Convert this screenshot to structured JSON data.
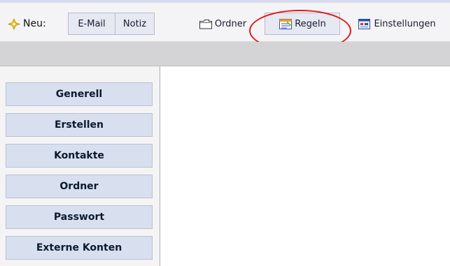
{
  "toolbar": {
    "new_label": "Neu:",
    "new_icon": "sparkle-star-icon",
    "email_label": "E-Mail",
    "note_label": "Notiz",
    "folder_label": "Ordner",
    "folder_icon": "folder-icon",
    "rules_label": "Regeln",
    "rules_icon": "rules-icon",
    "settings_label": "Einstellungen",
    "settings_icon": "settings-icon"
  },
  "sidebar": {
    "items": [
      {
        "label": "Generell"
      },
      {
        "label": "Erstellen"
      },
      {
        "label": "Kontakte"
      },
      {
        "label": "Ordner"
      },
      {
        "label": "Passwort"
      },
      {
        "label": "Externe Konten"
      }
    ]
  },
  "annotation": {
    "highlight_color": "#e01919",
    "highlighted_target": "rules-button"
  },
  "colors": {
    "nav_bg": "#d8dfee",
    "toolbar_bg": "#f4f4f6",
    "graybar_bg": "#d4d4d6"
  }
}
